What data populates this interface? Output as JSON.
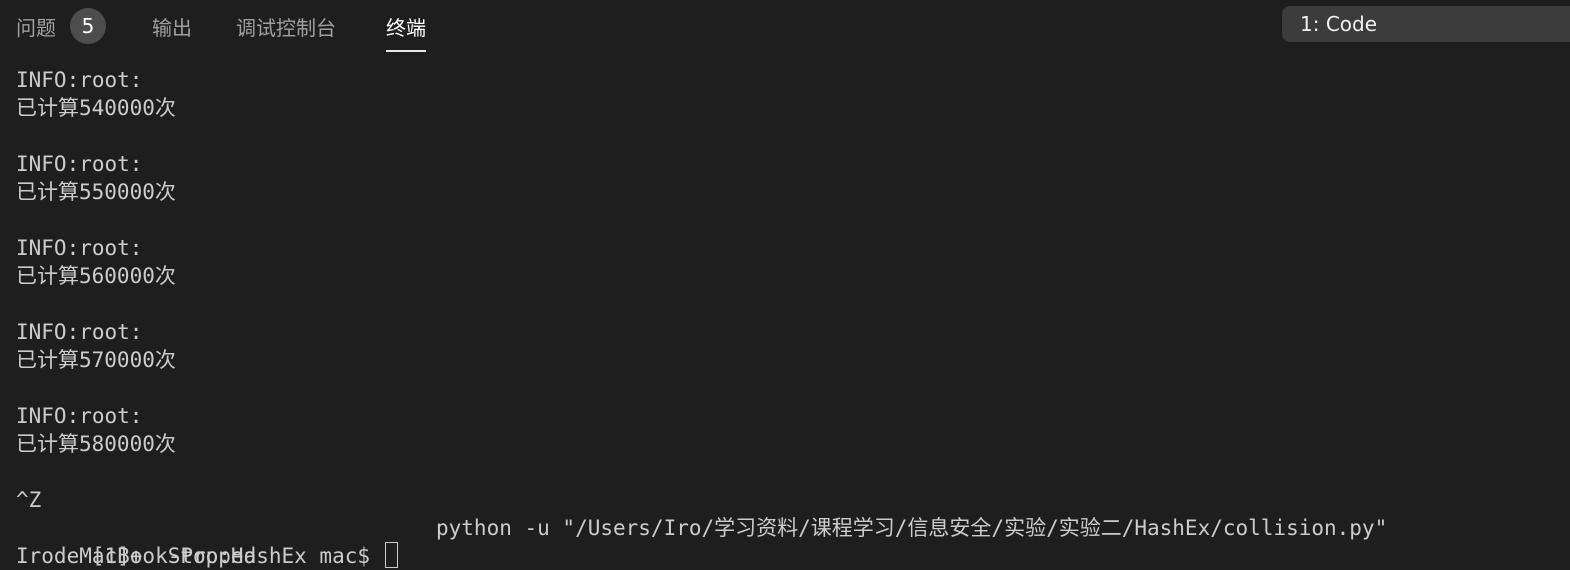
{
  "tabs": {
    "problems": {
      "label": "问题",
      "count": "5"
    },
    "output": {
      "label": "输出"
    },
    "debug_console": {
      "label": "调试控制台"
    },
    "terminal": {
      "label": "终端",
      "active": true
    }
  },
  "terminal_selector": {
    "value": "1: Code"
  },
  "terminal_output": {
    "entries": [
      {
        "logger": "INFO:root:",
        "message": "已计算540000次"
      },
      {
        "logger": "INFO:root:",
        "message": "已计算550000次"
      },
      {
        "logger": "INFO:root:",
        "message": "已计算560000次"
      },
      {
        "logger": "INFO:root:",
        "message": "已计算570000次"
      },
      {
        "logger": "INFO:root:",
        "message": "已计算580000次"
      }
    ],
    "interrupt": "^Z",
    "job_status": "[1]+  Stopped",
    "job_command": "python -u \"/Users/Iro/学习资料/课程学习/信息安全/实验/实验二/HashEx/collision.py\"",
    "prompt": "IrodeMacBook-Pro:HashEx mac$ "
  },
  "colors": {
    "background": "#1e1e1e",
    "text": "#cccccc",
    "tab_inactive": "#a0a0a0",
    "tab_active": "#ffffff",
    "badge_bg": "#4d4d4d",
    "select_bg": "#3c3c3c"
  }
}
